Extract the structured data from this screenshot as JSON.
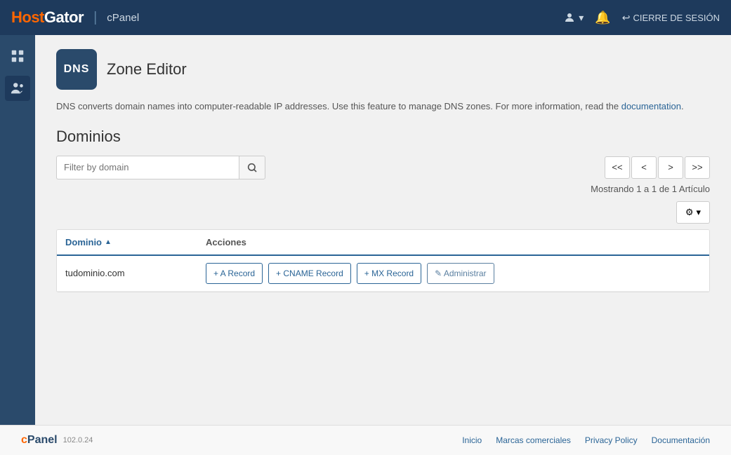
{
  "topnav": {
    "logo": "HostGator",
    "cpanel": "cPanel",
    "signout_label": "CIERRE DE SESIÓN"
  },
  "page": {
    "title": "Zone Editor",
    "description": "DNS converts domain names into computer-readable IP addresses. Use this feature to manage DNS zones. For more information, read the",
    "doc_link_text": "documentation",
    "doc_link_end": ".",
    "section_title": "Dominios"
  },
  "filter": {
    "placeholder": "Filter by domain"
  },
  "pagination": {
    "first": "<<",
    "prev": "<",
    "next": ">",
    "last": ">>"
  },
  "showing": {
    "text": "Mostrando 1 a 1 de 1 Artículo"
  },
  "table": {
    "col_domain": "Dominio",
    "col_actions": "Acciones",
    "sort_icon": "▲"
  },
  "domain_row": {
    "domain": "tudominio.com",
    "btn_a": "+ A Record",
    "btn_cname": "+ CNAME Record",
    "btn_mx": "+ MX Record",
    "btn_admin": "✎ Administrar"
  },
  "footer": {
    "logo": "cPanel",
    "version": "102.0.24",
    "links": [
      {
        "label": "Inicio"
      },
      {
        "label": "Marcas comerciales"
      },
      {
        "label": "Privacy Policy"
      },
      {
        "label": "Documentación"
      }
    ]
  }
}
